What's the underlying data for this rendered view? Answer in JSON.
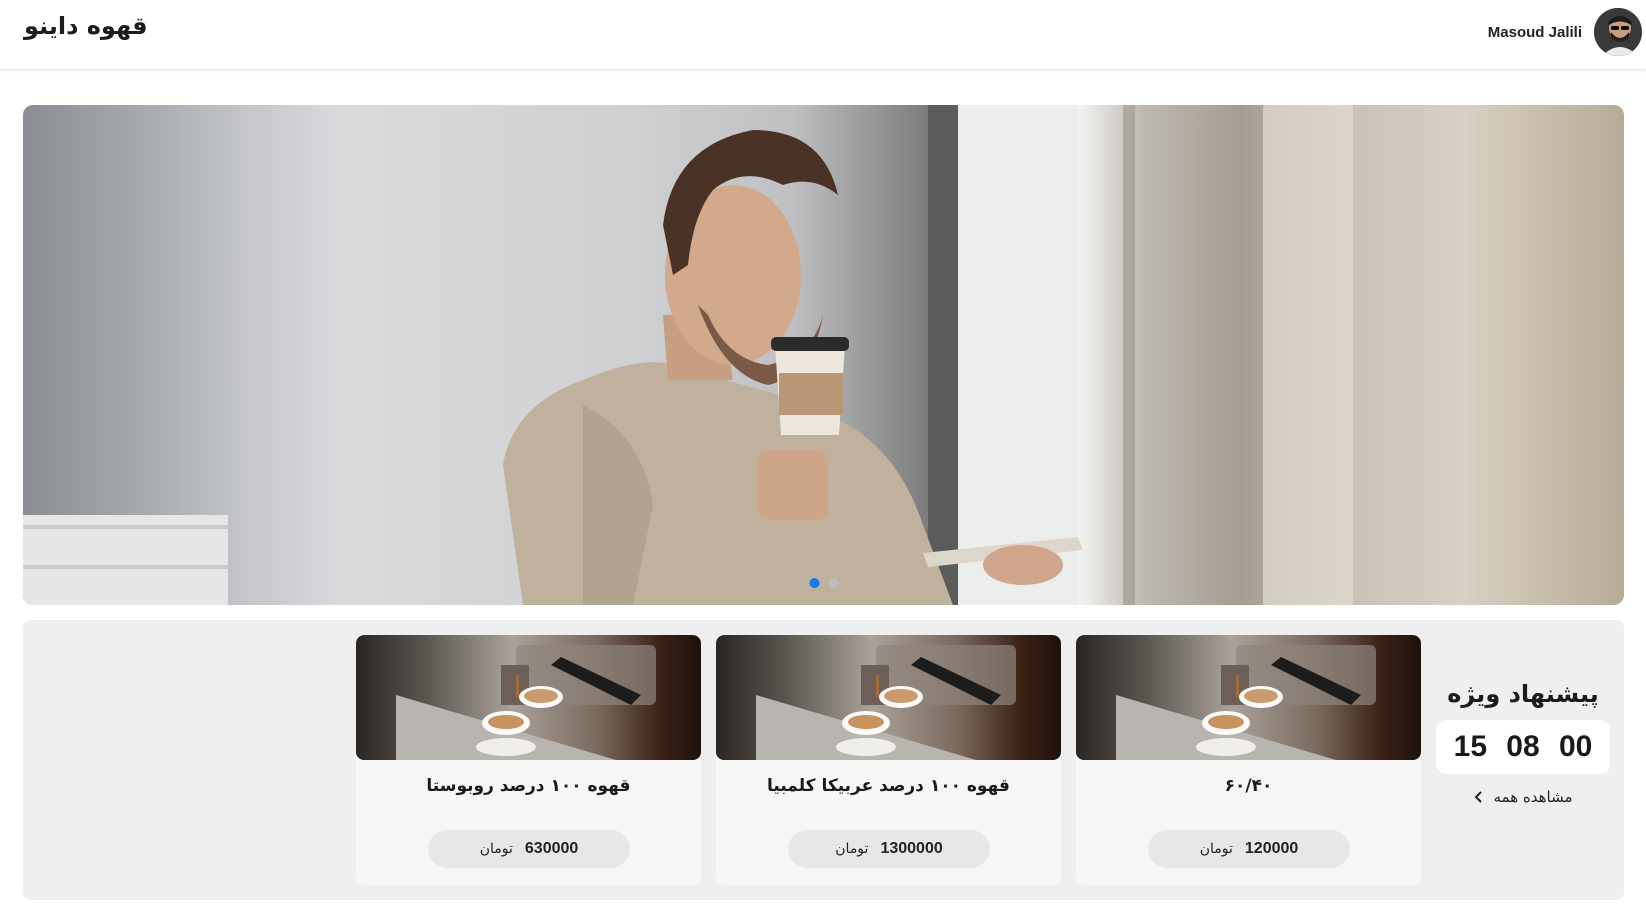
{
  "header": {
    "brand": "قهوه داینو",
    "user_name": "Masoud Jalili"
  },
  "hero": {
    "active_slide": 1,
    "slide_count": 2
  },
  "offer": {
    "title": "پیشنهاد ویژه",
    "timer": {
      "a": "15",
      "b": "08",
      "c": "00"
    },
    "see_all": "مشاهده همه"
  },
  "products": [
    {
      "title": "۶۰/۴۰",
      "price": "120000",
      "currency": "تومان"
    },
    {
      "title": "قهوه ۱۰۰ درصد عربیکا کلمبیا",
      "price": "1300000",
      "currency": "تومان"
    },
    {
      "title": "قهوه ۱۰۰ درصد روبوستا",
      "price": "630000",
      "currency": "تومان"
    }
  ],
  "colors": {
    "accent": "#1877f2",
    "section_bg": "#efefef",
    "card_bg": "#f6f6f6",
    "price_pill": "#e7e7e7"
  },
  "icons": [
    "chevron-left-icon"
  ]
}
